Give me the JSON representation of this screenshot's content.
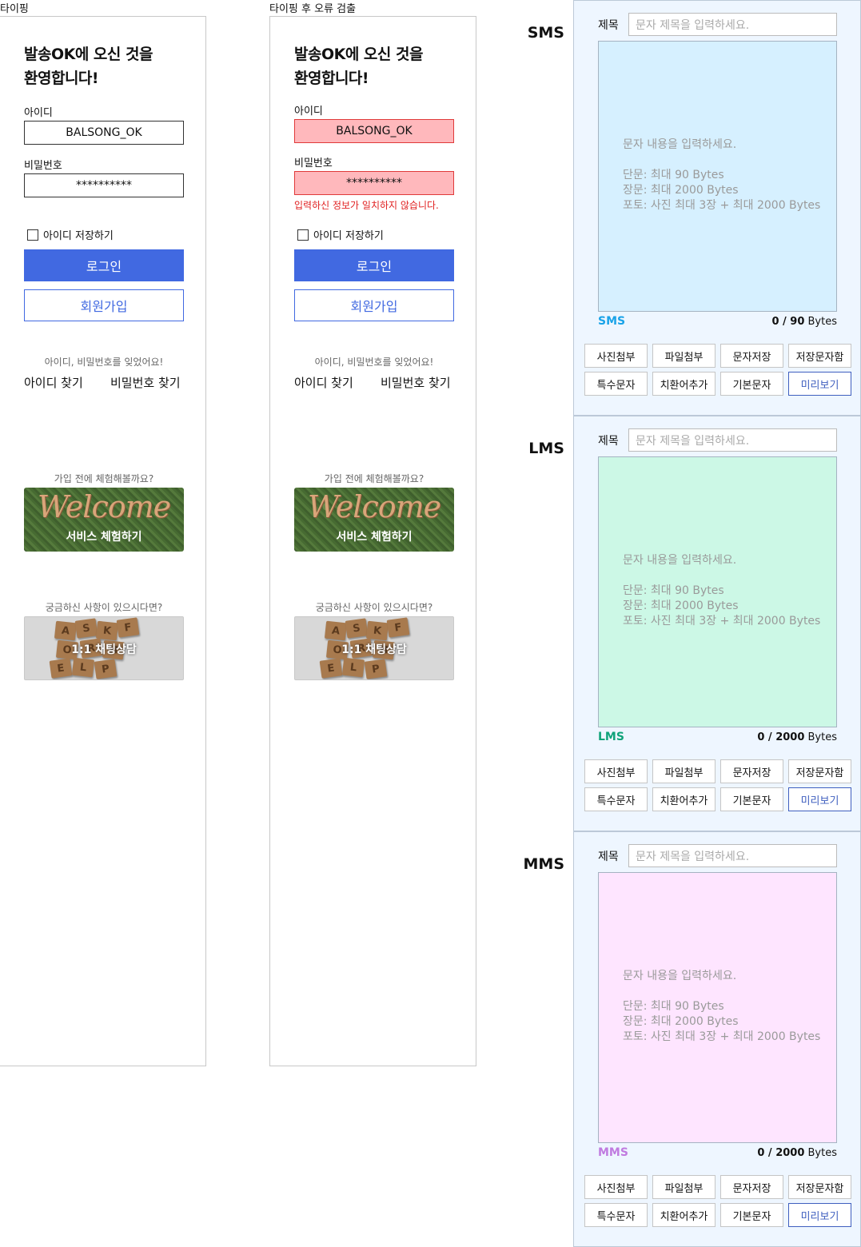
{
  "frames": [
    {
      "title": "타이핑",
      "welcome_line1": "발송OK에 오신 것을",
      "welcome_line2": "환영합니다!",
      "id_label": "아이디",
      "id_value": "BALSONG_OK",
      "pw_label": "비밀번호",
      "pw_value": "**********",
      "error_message": "",
      "remember_label": "아이디 저장하기",
      "login_label": "로그인",
      "join_label": "회원가입",
      "forgot_text": "아이디, 비밀번호를 잊었어요!",
      "find_id": "아이디 찾기",
      "find_pw": "비밀번호 찾기",
      "trial_question": "가입 전에 체험해볼까요?",
      "trial_script": "Welcome",
      "trial_button": "서비스 체험하기",
      "help_question": "궁금하신 사항이 있으시다면?",
      "help_button": "1:1 채팅상담"
    },
    {
      "title": "타이핑 후 오류 검출",
      "welcome_line1": "발송OK에 오신 것을",
      "welcome_line2": "환영합니다!",
      "id_label": "아이디",
      "id_value": "BALSONG_OK",
      "pw_label": "비밀번호",
      "pw_value": "**********",
      "error_message": "입력하신 정보가 일치하지 않습니다.",
      "remember_label": "아이디 저장하기",
      "login_label": "로그인",
      "join_label": "회원가입",
      "forgot_text": "아이디, 비밀번호를 잊었어요!",
      "find_id": "아이디 찾기",
      "find_pw": "비밀번호 찾기",
      "trial_question": "가입 전에 체험해볼까요?",
      "trial_script": "Welcome",
      "trial_button": "서비스 체험하기",
      "help_question": "궁금하신 사항이 있으시다면?",
      "help_button": "1:1 채팅상담"
    }
  ],
  "help_tiles": [
    "A",
    "S",
    "K",
    "F",
    "O",
    "R",
    "H",
    "E",
    "L",
    "P"
  ],
  "panels": [
    {
      "type_label": "SMS",
      "title_label": "제목",
      "title_placeholder": "문자 제목을 입력하세요.",
      "placeholder_main": "문자 내용을 입력하세요.",
      "placeholder_short": "단문: 최대 90 Bytes",
      "placeholder_long": "장문: 최대 2000 Bytes",
      "placeholder_photo": "포토: 사진 최대 3장 + 최대 2000 Bytes",
      "type_tag": "SMS",
      "bytes_count": "0 / 90",
      "bytes_unit": "Bytes",
      "area_color": "#d6f0ff",
      "tag_color": "#1aa3e8"
    },
    {
      "type_label": "LMS",
      "title_label": "제목",
      "title_placeholder": "문자 제목을 입력하세요.",
      "placeholder_main": "문자 내용을 입력하세요.",
      "placeholder_short": "단문: 최대 90 Bytes",
      "placeholder_long": "장문: 최대 2000 Bytes",
      "placeholder_photo": "포토: 사진 최대 3장 + 최대 2000 Bytes",
      "type_tag": "LMS",
      "bytes_count": "0 / 2000",
      "bytes_unit": "Bytes",
      "area_color": "#ccf8e6",
      "tag_color": "#10a37a"
    },
    {
      "type_label": "MMS",
      "title_label": "제목",
      "title_placeholder": "문자 제목을 입력하세요.",
      "placeholder_main": "문자 내용을 입력하세요.",
      "placeholder_short": "단문: 최대 90 Bytes",
      "placeholder_long": "장문: 최대 2000 Bytes",
      "placeholder_photo": "포토: 사진 최대 3장 + 최대 2000 Bytes",
      "type_tag": "MMS",
      "bytes_count": "0 / 2000",
      "bytes_unit": "Bytes",
      "area_color": "#fee5ff",
      "tag_color": "#c07be0"
    }
  ],
  "panel_buttons": [
    "사진첨부",
    "파일첨부",
    "문자저장",
    "저장문자함",
    "특수문자",
    "치환어추가",
    "기본문자",
    "미리보기"
  ],
  "colors": {
    "primary": "#4169e1",
    "error_bg": "#ffb8bc",
    "error_text": "#e02020"
  }
}
